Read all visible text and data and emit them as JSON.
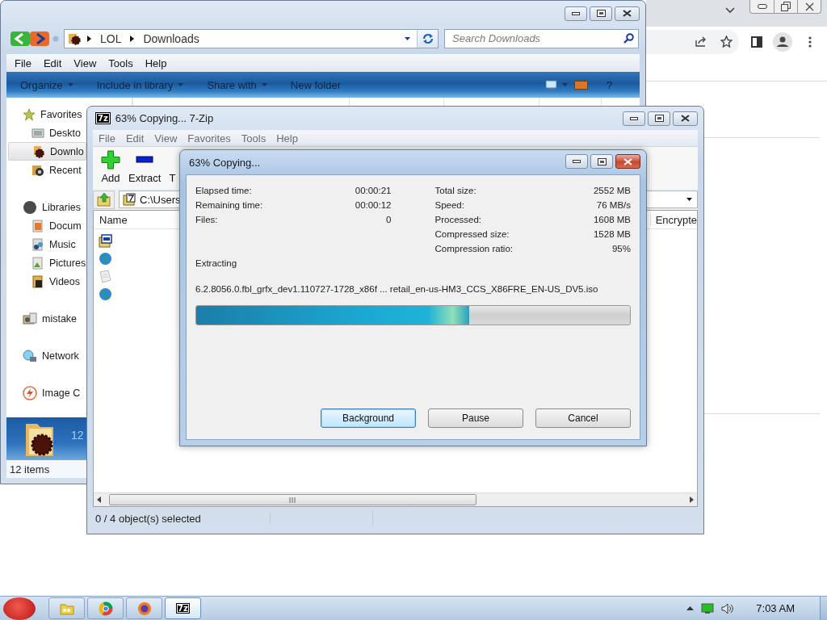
{
  "explorer": {
    "breadcrumb": [
      "LOL",
      "Downloads"
    ],
    "search": {
      "placeholder": "Search Downloads"
    },
    "menu": [
      "File",
      "Edit",
      "View",
      "Tools",
      "Help"
    ],
    "toolbar": [
      {
        "label": "Organize",
        "has_menu": true
      },
      {
        "label": "Include in library",
        "has_menu": true
      },
      {
        "label": "Share with",
        "has_menu": true
      },
      {
        "label": "New folder",
        "has_menu": false
      }
    ],
    "help": "?",
    "sidebar": [
      {
        "label": "Favorites",
        "selected": false,
        "children": [
          {
            "label": "Deskto",
            "selected": false
          },
          {
            "label": "Downlo",
            "selected": true
          },
          {
            "label": "Recent",
            "selected": false
          }
        ]
      },
      {
        "label": "Libraries",
        "selected": false,
        "children": [
          {
            "label": "Docum",
            "selected": false
          },
          {
            "label": "Music",
            "selected": false
          },
          {
            "label": "Pictures",
            "selected": false
          },
          {
            "label": "Videos",
            "selected": false
          }
        ]
      },
      {
        "label": "mistake",
        "selected": false
      },
      {
        "label": "Network",
        "selected": false
      },
      {
        "label": "Image C",
        "selected": false
      }
    ],
    "details": {
      "count": "12"
    },
    "status": "12 items"
  },
  "sevenzip": {
    "logo": "7z",
    "title": "63% Copying... 7-Zip",
    "menu": [
      "File",
      "Edit",
      "View",
      "Favorites",
      "Tools",
      "Help"
    ],
    "toolbar": [
      "Add",
      "Extract",
      "T"
    ],
    "path": "C:\\Users",
    "columns": [
      "Name",
      "Encrypte"
    ],
    "status": "0 / 4 object(s) selected"
  },
  "dialog": {
    "title": "63% Copying...",
    "left_stats": [
      {
        "label": "Elapsed time:",
        "value": "00:00:21"
      },
      {
        "label": "Remaining time:",
        "value": "00:00:12"
      },
      {
        "label": "Files:",
        "value": "0"
      }
    ],
    "right_stats": [
      {
        "label": "Total size:",
        "value": "2552 MB"
      },
      {
        "label": "Speed:",
        "value": "76 MB/s"
      },
      {
        "label": "Processed:",
        "value": "1608 MB"
      },
      {
        "label": "Compressed size:",
        "value": "1528 MB"
      },
      {
        "label": "Compression ratio:",
        "value": "95%"
      }
    ],
    "operation": "Extracting",
    "file": "6.2.8056.0.fbl_grfx_dev1.110727-1728_x86f ... retail_en-us-HM3_CCS_X86FRE_EN-US_DV5.iso",
    "progress": {
      "level": 0.63
    },
    "buttons": [
      {
        "label": "Background",
        "selected": true
      },
      {
        "label": "Pause",
        "selected": false
      },
      {
        "label": "Cancel",
        "selected": false
      }
    ]
  },
  "taskbar": {
    "items": [
      {
        "selected": false
      },
      {
        "selected": false
      },
      {
        "selected": false
      },
      {
        "selected": true,
        "logo": "7z"
      }
    ],
    "clock": "7:03 AM"
  }
}
